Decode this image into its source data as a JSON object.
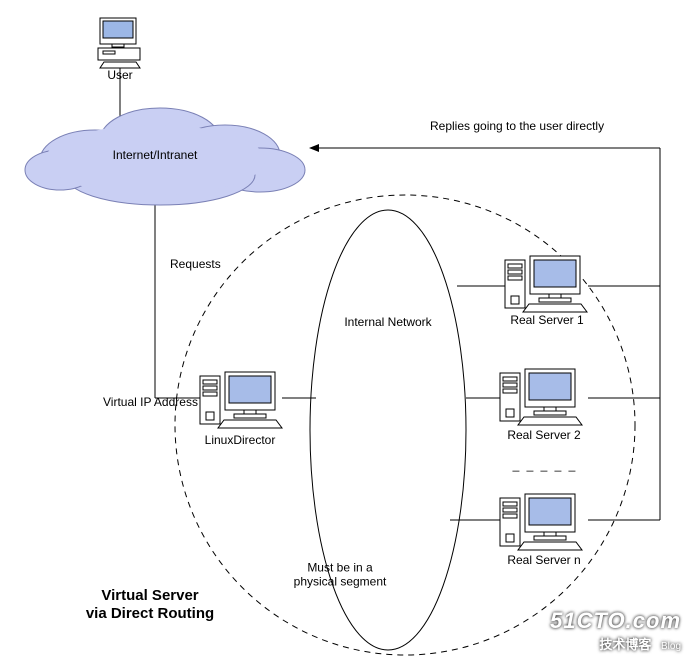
{
  "user_label": "User",
  "cloud_label": "Internet/Intranet",
  "requests_label": "Requests",
  "vip_label": "Virtual IP Address",
  "director_label": "LinuxDirector",
  "internal_net_label": "Internal Network",
  "segment_note": "Must be in a\nphysical segment",
  "replies_label": "Replies going to the user directly",
  "servers": {
    "s1": "Real Server 1",
    "s2": "Real Server 2",
    "sn": "Real Server n",
    "ellipsis": "_ _ _ _ _"
  },
  "title_line1": "Virtual Server",
  "title_line2": "via Direct Routing",
  "watermark": {
    "main": "51CTO.com",
    "sub": "技术博客",
    "tag": "Blog"
  }
}
